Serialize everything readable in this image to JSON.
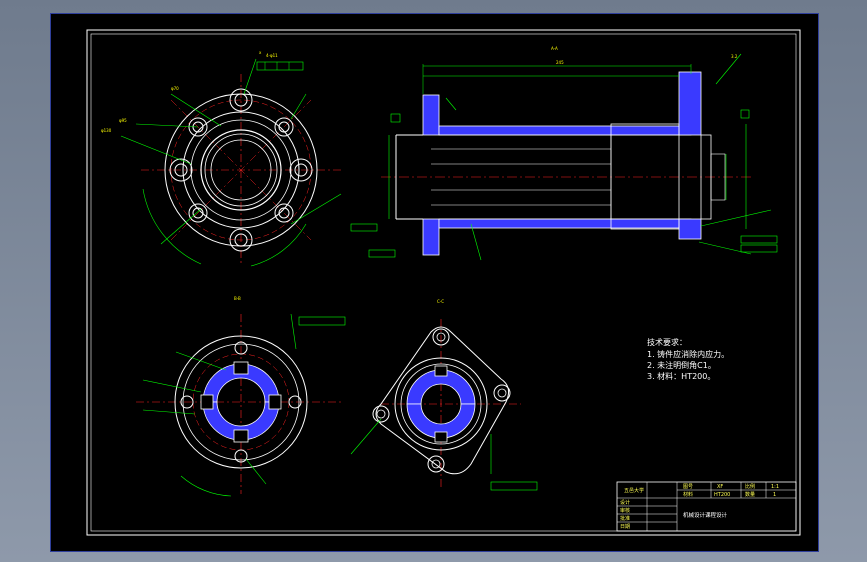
{
  "drawing": {
    "section_labels": {
      "aa": "A-A",
      "bb": "B-B",
      "cc": "C-C"
    },
    "technical_requirements": {
      "heading": "技术要求：",
      "items": [
        "1. 铸件应消除内应力。",
        "2. 未注明倒角C1。",
        "3. 材料：HT200。"
      ]
    },
    "title_block": {
      "drawing_title": "机械设计课程设计",
      "labels": {
        "designer": "设计",
        "checker": "审核",
        "approver": "批准",
        "date": "日期",
        "drawing_no_label": "图号",
        "material_label": "材料",
        "scale_label": "比例",
        "quantity_label": "数量"
      },
      "values": {
        "drawing_no": "XF",
        "material": "HT200",
        "scale": "1:1",
        "quantity": "1",
        "company": "五邑大学"
      }
    }
  },
  "colors": {
    "outline": "#ffffff",
    "centerline": "#ff2222",
    "dimension": "#00ff00",
    "hatch": "#3a3aff",
    "annotation": "#ffff00",
    "frame": "#ffffff",
    "viewport_border": "#2f3f9c"
  }
}
